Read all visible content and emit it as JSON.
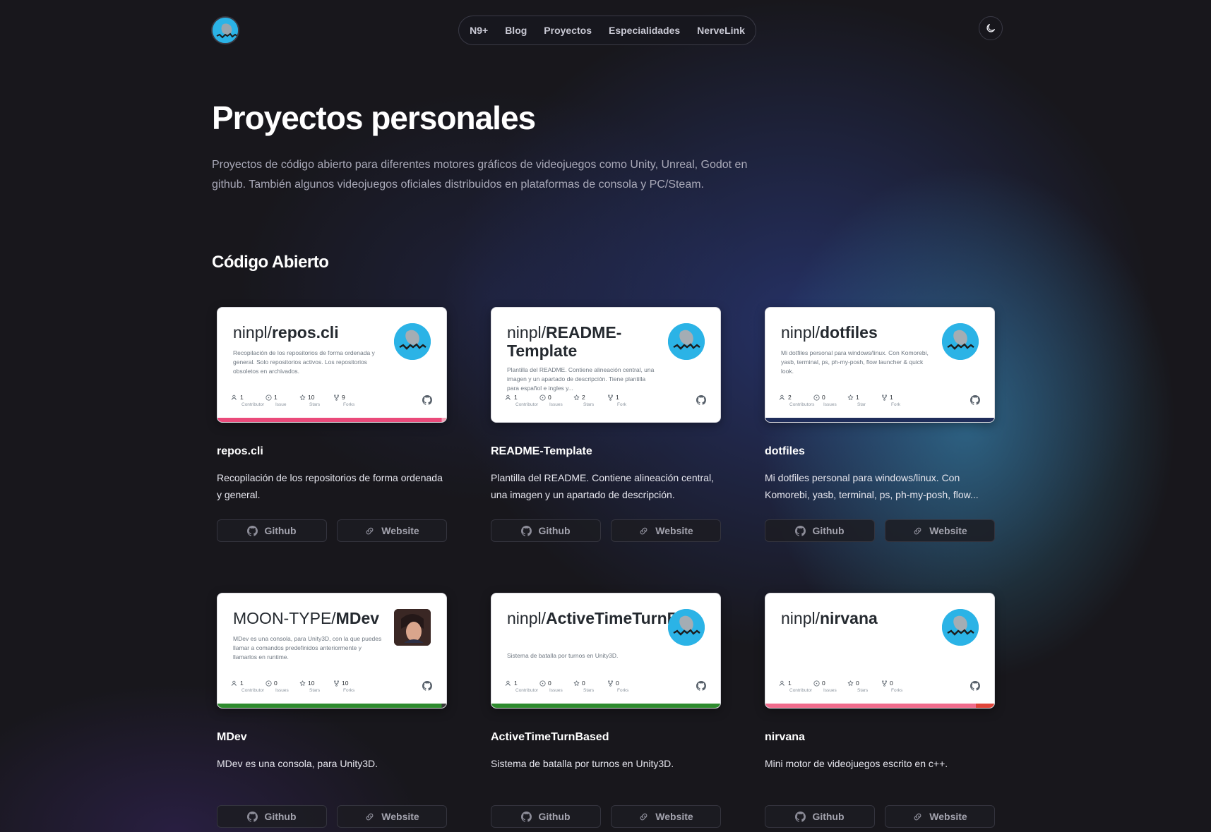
{
  "nav": {
    "items": [
      "N9+",
      "Blog",
      "Proyectos",
      "Especialidades",
      "NerveLink"
    ]
  },
  "hero": {
    "title": "Proyectos personales",
    "description": "Proyectos de código abierto para diferentes motores gráficos de videojuegos como Unity, Unreal, Godot en github. También algunos videojuegos oficiales distribuidos en plataformas de consola y PC/Steam."
  },
  "section": {
    "title": "Código Abierto"
  },
  "buttons": {
    "github": "Github",
    "website": "Website"
  },
  "projects": [
    {
      "owner": "ninpl/",
      "repo": "repos.cli",
      "preview_desc": "Recopilación de los repositorios de forma ordenada y general. Solo repositorios activos. Los repositorios obsoletos en archivados.",
      "stats": [
        {
          "value": "1",
          "label": "Contributor"
        },
        {
          "value": "1",
          "label": "Issue"
        },
        {
          "value": "10",
          "label": "Stars"
        },
        {
          "value": "9",
          "label": "Forks"
        }
      ],
      "bar_color": "#ea4a7a",
      "title": "repos.cli",
      "description": "Recopilación de los repositorios de forma ordenada y general."
    },
    {
      "owner": "ninpl/",
      "repo": "README-Template",
      "preview_desc": "Plantilla del README. Contiene alineación central, una imagen y un apartado de descripción. Tiene plantilla para español e ingles y...",
      "stats": [
        {
          "value": "1",
          "label": "Contributor"
        },
        {
          "value": "0",
          "label": "Issues"
        },
        {
          "value": "2",
          "label": "Stars"
        },
        {
          "value": "1",
          "label": "Fork"
        }
      ],
      "bar_color": "#ffffff",
      "title": "README-Template",
      "description": "Plantilla del README. Contiene alineación central, una imagen y un apartado de descripción."
    },
    {
      "owner": "ninpl/",
      "repo": "dotfiles",
      "preview_desc": "Mi dotfiles personal para windows/linux. Con Komorebi, yasb, terminal, ps, ph-my-posh, flow launcher & quick look.",
      "stats": [
        {
          "value": "2",
          "label": "Contributors"
        },
        {
          "value": "0",
          "label": "Issues"
        },
        {
          "value": "1",
          "label": "Star"
        },
        {
          "value": "1",
          "label": "Fork"
        }
      ],
      "bar_color": "#1f2d5a",
      "title": "dotfiles",
      "description": "Mi dotfiles personal para windows/linux. Con Komorebi, yasb, terminal, ps, ph-my-posh, flow..."
    },
    {
      "owner": "MOON-TYPE/",
      "repo": "MDev",
      "preview_desc": "MDev es una consola, para Unity3D, con la que puedes llamar a comandos predefinidos anteriormente y llamarlos en runtime.",
      "stats": [
        {
          "value": "1",
          "label": "Contributor"
        },
        {
          "value": "0",
          "label": "Issues"
        },
        {
          "value": "10",
          "label": "Stars"
        },
        {
          "value": "10",
          "label": "Forks"
        }
      ],
      "bar_color": "#2e8b2e",
      "title": "MDev",
      "description": "MDev es una consola, para Unity3D."
    },
    {
      "owner": "ninpl/",
      "repo": "ActiveTimeTurnBa...",
      "preview_desc": "Sistema de batalla por turnos en Unity3D.",
      "stats": [
        {
          "value": "1",
          "label": "Contributor"
        },
        {
          "value": "0",
          "label": "Issues"
        },
        {
          "value": "0",
          "label": "Stars"
        },
        {
          "value": "0",
          "label": "Forks"
        }
      ],
      "bar_color": "#2e8b2e",
      "title": "ActiveTimeTurnBased",
      "description": "Sistema de batalla por turnos en Unity3D."
    },
    {
      "owner": "ninpl/",
      "repo": "nirvana",
      "preview_desc": "",
      "stats": [
        {
          "value": "1",
          "label": "Contributor"
        },
        {
          "value": "0",
          "label": "Issues"
        },
        {
          "value": "0",
          "label": "Stars"
        },
        {
          "value": "0",
          "label": "Forks"
        }
      ],
      "bar_color": "#f06b8c",
      "title": "nirvana",
      "description": "Mini motor de videojuegos escrito en c++."
    }
  ]
}
